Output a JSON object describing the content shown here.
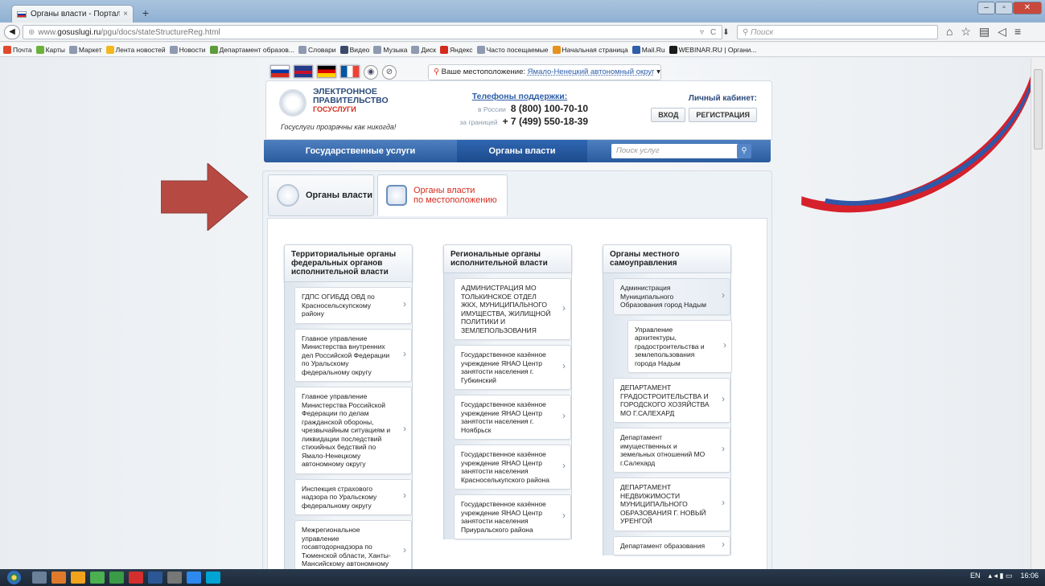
{
  "browser": {
    "tab_title": "Органы власти - Портал г...",
    "tab_close": "×",
    "new_tab": "+",
    "url_prefix": "www.",
    "url_domain": "gosuslugi.ru",
    "url_path": "/pgu/docs/stateStructureReg.html",
    "search_placeholder": "Поиск",
    "bookmarks": [
      {
        "label": "Почта",
        "color": "#e04a2b"
      },
      {
        "label": "Карты",
        "color": "#6bb23a"
      },
      {
        "label": "Маркет",
        "color": "#8e9ab0"
      },
      {
        "label": "Лента новостей",
        "color": "#f2b81c"
      },
      {
        "label": "Новости",
        "color": "#8e9ab0"
      },
      {
        "label": "Департамент образов...",
        "color": "#5d9c3a"
      },
      {
        "label": "Словари",
        "color": "#8e9ab0"
      },
      {
        "label": "Видео",
        "color": "#3a4b6a"
      },
      {
        "label": "Музыка",
        "color": "#8e9ab0"
      },
      {
        "label": "Диск",
        "color": "#8e9ab0"
      },
      {
        "label": "Яндекс",
        "color": "#d52b1e"
      },
      {
        "label": "Часто посещаемые",
        "color": "#8e9ab0"
      },
      {
        "label": "Начальная страница",
        "color": "#e6921e"
      },
      {
        "label": "Mail.Ru",
        "color": "#2d5ea8"
      },
      {
        "label": "WEBINAR.RU | Органи...",
        "color": "#1a1a1a"
      }
    ]
  },
  "header": {
    "location_label": "Ваше местоположение:",
    "location_value": "Ямало-Ненецкий автономный округ",
    "logo_line1": "ЭЛЕКТРОННОЕ",
    "logo_line2": "ПРАВИТЕЛЬСТВО",
    "logo_line3": "ГОСУСЛУГИ",
    "slogan": "Госуслуги прозрачны как никогда!",
    "phones_title": "Телефоны поддержки:",
    "phone_ru_label": "в России",
    "phone_ru": "8 (800) 100-70-10",
    "phone_abroad_label": "за границей",
    "phone_abroad": "+ 7 (499) 550-18-39",
    "cabinet_title": "Личный кабинет:",
    "login": "ВХОД",
    "register": "РЕГИСТРАЦИЯ"
  },
  "menu": {
    "item1": "Государственные услуги",
    "item2": "Органы власти",
    "search_placeholder": "Поиск услуг"
  },
  "tabs": {
    "tab1": "Органы власти",
    "tab2_line1": "Органы власти",
    "tab2_line2": "по местоположению"
  },
  "columns": [
    {
      "title": "Территориальные органы федеральных органов исполнительной власти",
      "items": [
        "ГДПС ОГИБДД ОВД по Красносельскупскому району",
        "Главное управление Министерства внутренних дел Российской Федерации по Уральскому федеральному округу",
        "Главное управление Министерства Российской Федерации по делам гражданской обороны, чрезвычайным ситуациям и ликвидации последствий стихийных бедствий по Ямало-Ненецкому автономному округу",
        "Инспекция страхового надзора по Уральскому федеральному округу",
        "Межрегиональное управление госавтодорнадзора по Тюменской области, Ханты-Мансийскому автономному округу - Югре и Ямал -"
      ]
    },
    {
      "title": "Региональные органы исполнительной власти",
      "items": [
        "АДМИНИСТРАЦИЯ МО ТОЛЬКИНСКОЕ ОТДЕЛ ЖКХ, МУНИЦИПАЛЬНОГО ИМУЩЕСТВА, ЖИЛИЩНОЙ ПОЛИТИКИ И ЗЕМЛЕПОЛЬЗОВАНИЯ",
        "Государственное казённое учреждение ЯНАО Центр занятости населения г. Губкинский",
        "Государственное казённое учреждение ЯНАО Центр занятости населения г. Ноябрьск",
        "Государственное казённое учреждение ЯНАО Центр занятости населения Красноселькупского района",
        "Государственное казённое учреждение ЯНАО Центр занятости населения Приуральского района"
      ]
    },
    {
      "title": "Органы местного самоуправления",
      "items": [
        "Администрация Муниципального Образования город Надым",
        "Управление архитектуры, градостроительства и землепользования города Надым",
        "ДЕПАРТАМЕНТ ГРАДОСТРОИТЕЛЬСТВА И ГОРОДСКОГО ХОЗЯЙСТВА МО Г.САЛЕХАРД",
        "Департамент имущественных и земельных отношений МО г.Салехард",
        "ДЕПАРТАМЕНТ НЕДВИЖИМОСТИ МУНИЦИПАЛЬНОГО ОБРАЗОВАНИЯ Г. НОВЫЙ УРЕНГОЙ",
        "Департамент образования"
      ]
    }
  ],
  "taskbar": {
    "lang": "EN",
    "time": "16:06"
  },
  "colors": {
    "accent_red": "#d52b1e",
    "menu_blue": "#2a5b9e",
    "arrow": "#b64a43"
  }
}
